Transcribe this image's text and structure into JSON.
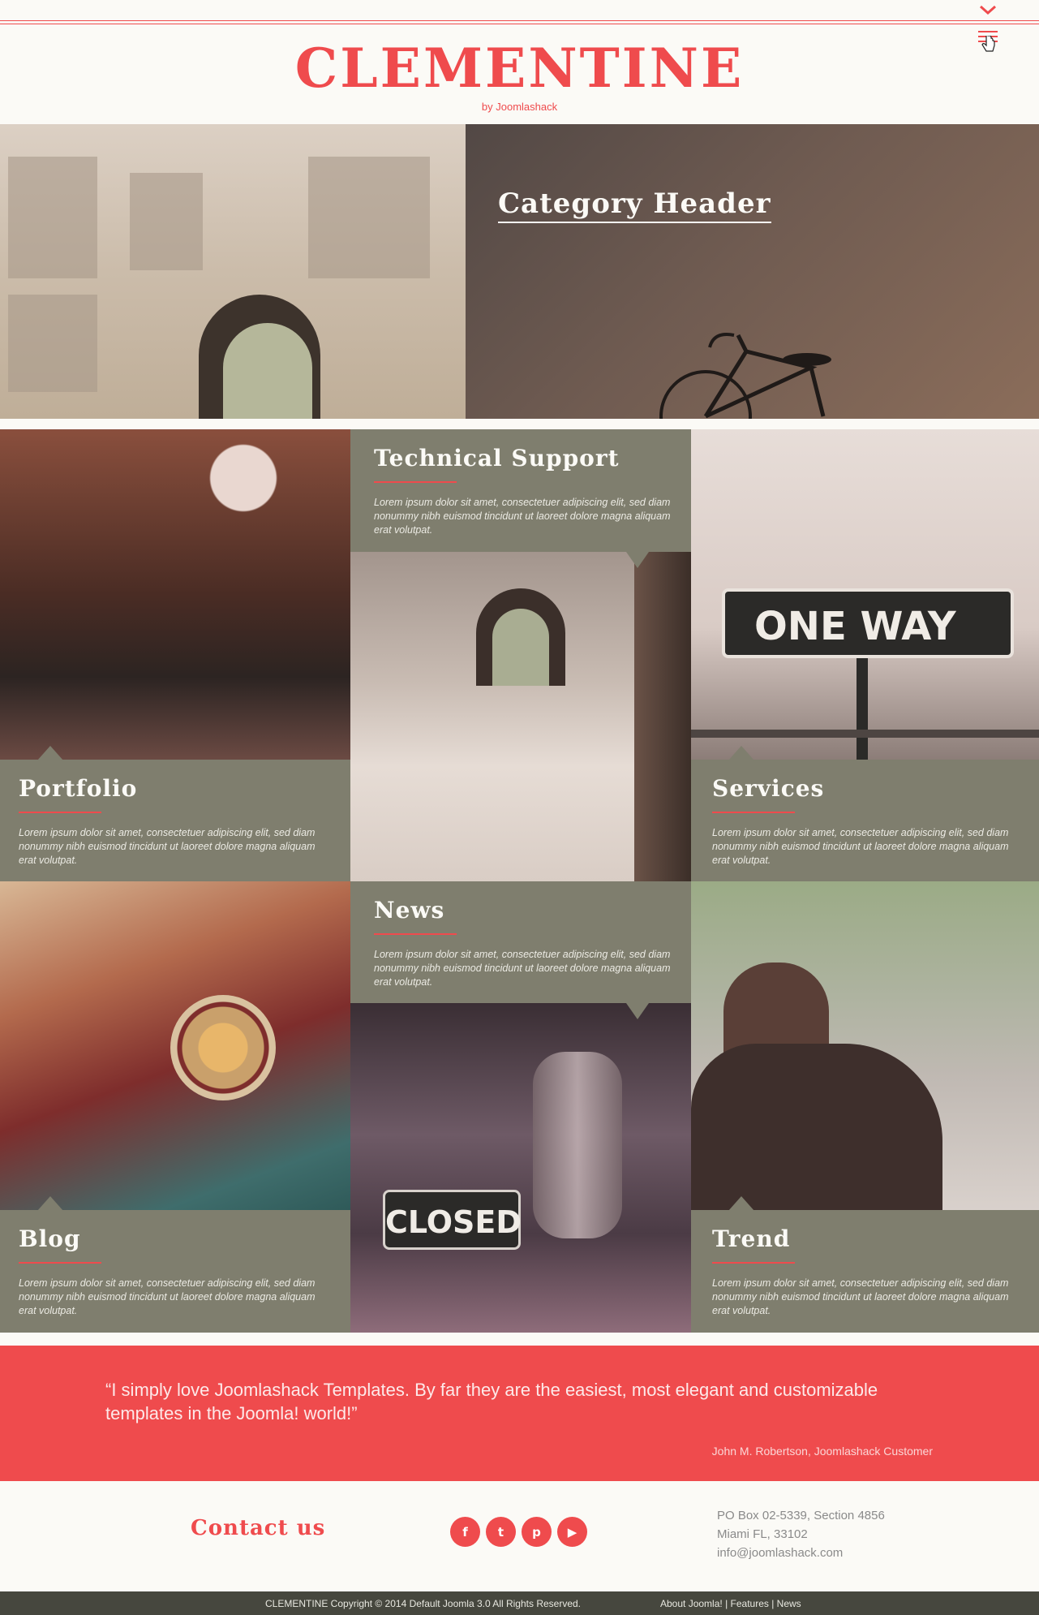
{
  "header": {
    "site_title": "CLEMENTINE",
    "byline": "by Joomlashack"
  },
  "hero": {
    "title": "Category Header"
  },
  "tiles": [
    {
      "title": "Technical Support",
      "text": "Lorem ipsum dolor sit amet, consectetuer adipiscing elit, sed diam nonummy nibh euismod tincidunt ut laoreet dolore magna aliquam erat volutpat."
    },
    {
      "title": "Portfolio",
      "text": "Lorem ipsum dolor sit amet, consectetuer adipiscing elit, sed diam nonummy nibh euismod tincidunt ut laoreet dolore magna aliquam erat volutpat."
    },
    {
      "title": "Services",
      "text": "Lorem ipsum dolor sit amet, consectetuer adipiscing elit, sed diam nonummy nibh euismod tincidunt ut laoreet dolore magna aliquam erat volutpat."
    },
    {
      "title": "News",
      "text": "Lorem ipsum dolor sit amet, consectetuer adipiscing elit, sed diam nonummy nibh euismod tincidunt ut laoreet dolore magna aliquam erat volutpat."
    },
    {
      "title": "Blog",
      "text": "Lorem ipsum dolor sit amet, consectetuer adipiscing elit, sed diam nonummy nibh euismod tincidunt ut laoreet dolore magna aliquam erat volutpat."
    },
    {
      "title": "Trend",
      "text": "Lorem ipsum dolor sit amet, consectetuer adipiscing elit, sed diam nonummy nibh euismod tincidunt ut laoreet dolore magna aliquam erat volutpat."
    }
  ],
  "images": {
    "one_way_sign": "ONE WAY",
    "closed_sign": "CLOSED"
  },
  "testimonial": {
    "quote": "“I simply love Joomlashack Templates. By far they are the easiest, most elegant and customizable templates in the Joomla! world!”",
    "author": "John M. Robertson, Joomlashack Customer"
  },
  "footer": {
    "contact_title": "Contact us",
    "socials": [
      {
        "icon": "facebook-icon",
        "glyph": "f"
      },
      {
        "icon": "twitter-icon",
        "glyph": "t"
      },
      {
        "icon": "pinterest-icon",
        "glyph": "p"
      },
      {
        "icon": "youtube-icon",
        "glyph": "▶"
      }
    ],
    "address_line1": "PO Box 02-5339, Section 4856",
    "address_line2": "Miami FL, 33102",
    "email": "info@joomlashack.com",
    "copyright": "CLEMENTINE Copyright © 2014 Default Joomla 3.0 All Rights Reserved.",
    "links": [
      "About Joomla!",
      "Features",
      "News"
    ]
  },
  "colors": {
    "accent": "#ef4b4d",
    "tile_bg": "#7f7e6e",
    "footer_bar": "#46473e"
  }
}
